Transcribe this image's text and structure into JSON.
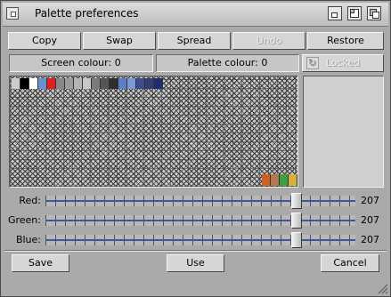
{
  "window": {
    "title": "Palette preferences"
  },
  "toolbar": {
    "copy": "Copy",
    "swap": "Swap",
    "spread": "Spread",
    "undo": "Undo",
    "restore": "Restore"
  },
  "info": {
    "screen_colour_label": "Screen colour:",
    "screen_colour_value": "0",
    "palette_colour_label": "Palette colour:",
    "palette_colour_value": "0",
    "locked_label": "Locked"
  },
  "palette": {
    "top_swatches": [
      "#cccccc",
      "#000000",
      "#ffffff",
      "#6a8fd0",
      "#e02020",
      "#888888",
      "#9a9a9a",
      "#b4b4b4",
      "#c8c8c8",
      "#7a7a7a",
      "#555555",
      "#2e2e2e",
      "#5a7fc8",
      "#7a9ad6",
      "#3a4f8a",
      "#32406e",
      "#1e2e6e"
    ],
    "bottom_swatches": [
      "#d06020",
      "#b07a50",
      "#40a040",
      "#d8b040"
    ]
  },
  "sliders": [
    {
      "label": "Red:",
      "value": "207",
      "level": 0.81
    },
    {
      "label": "Green:",
      "value": "207",
      "level": 0.81
    },
    {
      "label": "Blue:",
      "value": "207",
      "level": 0.81
    }
  ],
  "footer": {
    "save": "Save",
    "use": "Use",
    "cancel": "Cancel"
  }
}
